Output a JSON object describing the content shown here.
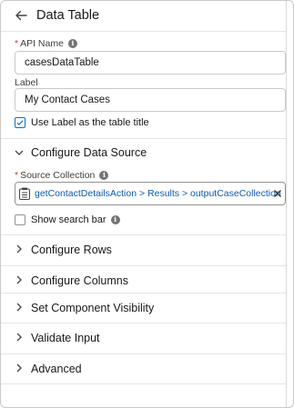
{
  "header": {
    "title": "Data Table",
    "back_icon": "arrow-left-icon"
  },
  "api_name": {
    "label": "API Name",
    "required_mark": "*",
    "value": "casesDataTable"
  },
  "label_field": {
    "label": "Label",
    "value": "My Contact Cases"
  },
  "use_label_checkbox": {
    "label": "Use Label as the table title",
    "checked": true
  },
  "data_source": {
    "title": "Configure Data Source",
    "expanded": true,
    "source_collection": {
      "label": "Source Collection",
      "required_mark": "*",
      "value": "getContactDetailsAction > Results > outputCaseCollection"
    },
    "search_bar": {
      "label": "Show search bar",
      "checked": false
    }
  },
  "sections": [
    {
      "title": "Configure Rows",
      "expanded": false
    },
    {
      "title": "Configure Columns",
      "expanded": false
    },
    {
      "title": "Set Component Visibility",
      "expanded": false
    },
    {
      "title": "Validate Input",
      "expanded": false
    },
    {
      "title": "Advanced",
      "expanded": false
    }
  ],
  "colors": {
    "link": "#0b5cab",
    "required": "#c23934",
    "accent": "#0176d3",
    "border": "#c9c9c9"
  },
  "info_glyph": "i"
}
